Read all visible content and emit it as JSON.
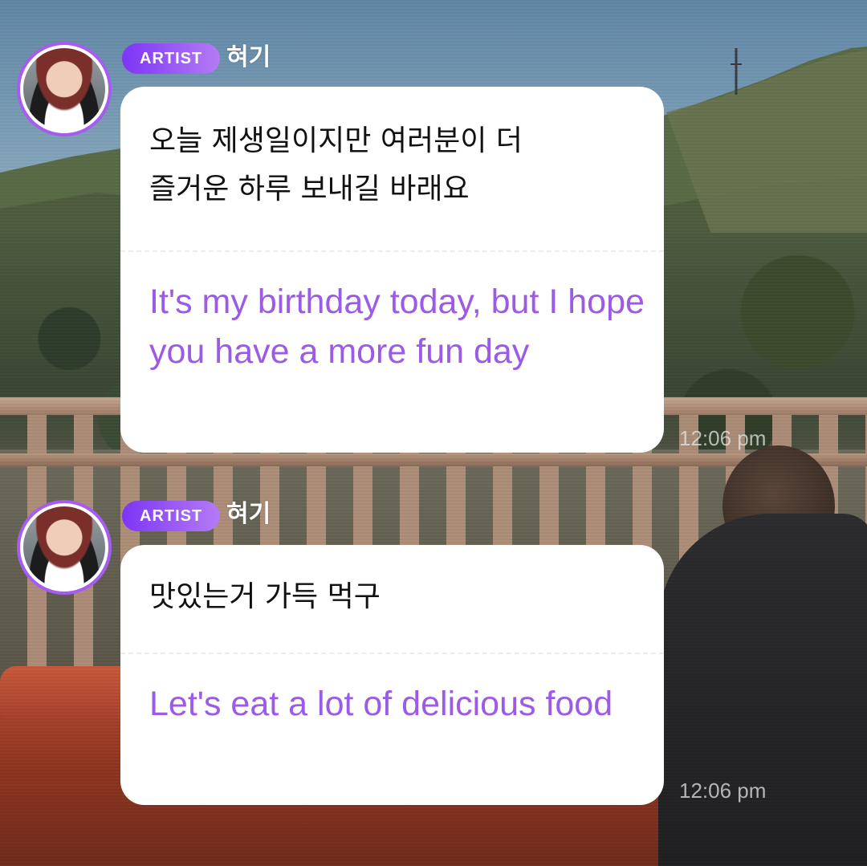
{
  "messages": [
    {
      "badge": "ARTIST",
      "author": "혀기",
      "original": "오늘 제생일이지만 여러분이 더\n즐거운 하루 보내길 바래요",
      "translation": "It's my birthday today, but I hope you have a more fun day",
      "time": "12:06 pm"
    },
    {
      "badge": "ARTIST",
      "author": "혀기",
      "original": "맛있는거 가득 먹구",
      "translation": "Let's eat a lot of delicious food",
      "time": "12:06 pm"
    }
  ],
  "colors": {
    "badge_start": "#7d35f5",
    "badge_end": "#b57bf5",
    "avatar_ring": "#a65cf0",
    "translation_text": "#9b5be6",
    "bubble_bg": "#ffffff"
  },
  "icons": {
    "avatar": "profile-photo"
  }
}
